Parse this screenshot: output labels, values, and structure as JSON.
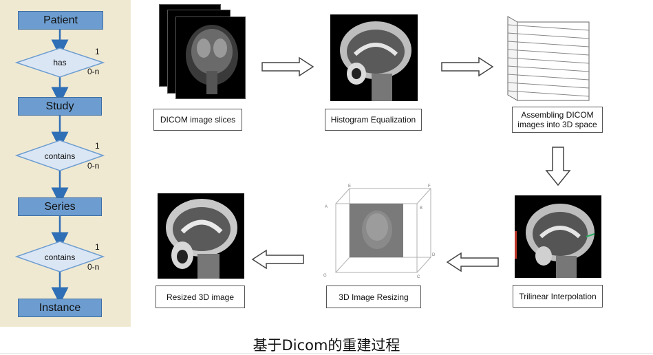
{
  "hierarchy": {
    "entities": [
      "Patient",
      "Study",
      "Series",
      "Instance"
    ],
    "relations": [
      "has",
      "contains",
      "contains"
    ],
    "cardinality_one": "1",
    "cardinality_many": "0-n"
  },
  "pipeline": {
    "steps": [
      {
        "label": "DICOM image slices"
      },
      {
        "label": "Histogram Equalization"
      },
      {
        "label_line1": "Assembling DICOM",
        "label_line2": "images into 3D space"
      },
      {
        "label": "Trilinear Interpolation"
      },
      {
        "label": "3D Image Resizing"
      },
      {
        "label": "Resized 3D image"
      }
    ],
    "cube_vertex_labels": [
      "E",
      "F",
      "A",
      "B",
      "D",
      "C",
      "G"
    ]
  },
  "caption": "基于Dicom的重建过程",
  "colors": {
    "entity_fill": "#6d9dd0",
    "relation_fill": "#dbe6f4",
    "connector": "#2f6fb5",
    "panel_bg": "#f0e9d2"
  }
}
